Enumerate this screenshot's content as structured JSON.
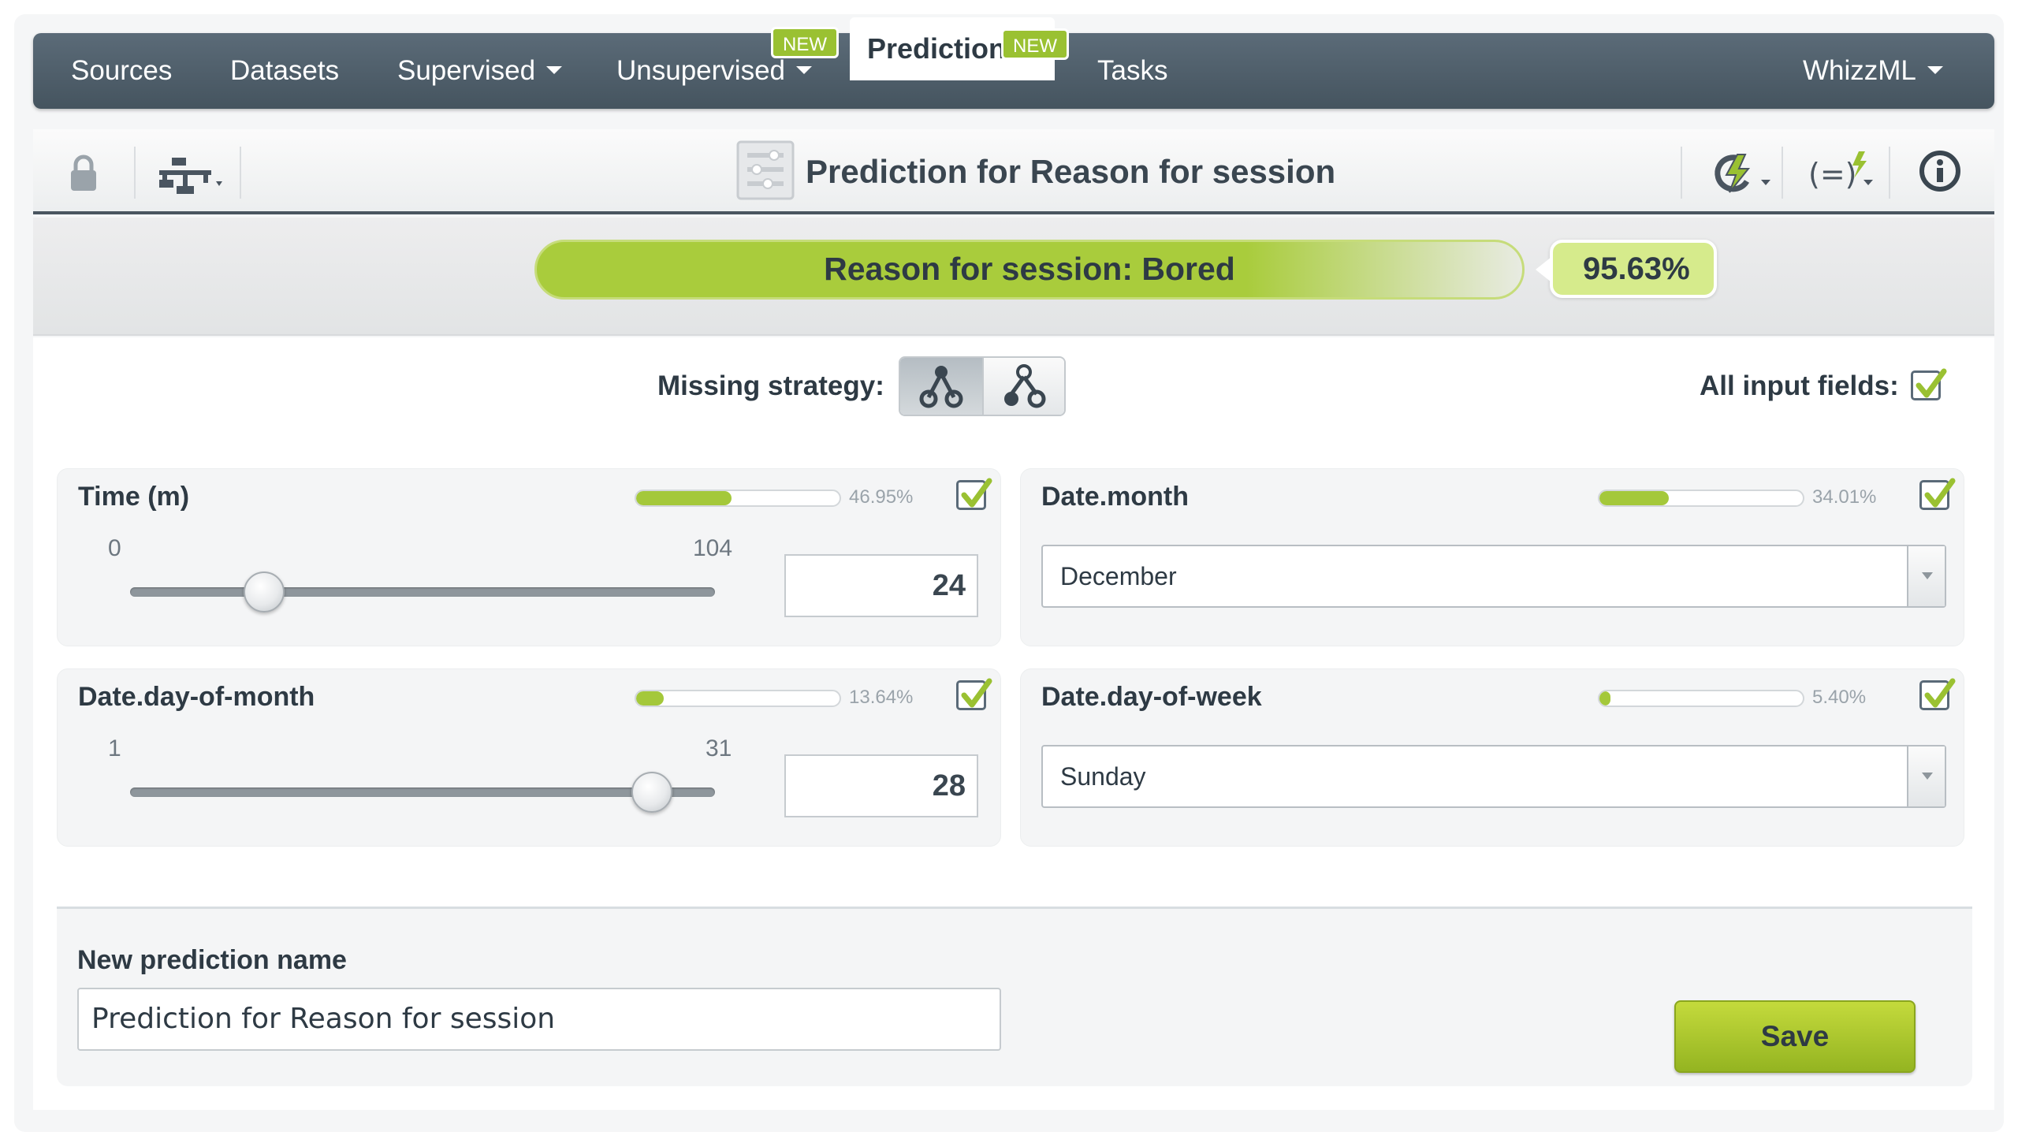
{
  "nav": {
    "items": [
      {
        "label": "Sources"
      },
      {
        "label": "Datasets"
      },
      {
        "label": "Supervised"
      },
      {
        "label": "Unsupervised",
        "badge": "NEW"
      },
      {
        "label": "Predictions",
        "badge": "NEW"
      },
      {
        "label": "Tasks"
      },
      {
        "label": "WhizzML"
      }
    ],
    "active": "Predictions"
  },
  "toolbar": {
    "title": "Prediction for Reason for session",
    "icons": [
      "lock-icon",
      "model-tree-icon",
      "predictions-icon",
      "formula-icon",
      "info-icon"
    ]
  },
  "result": {
    "label": "Reason for session: Bored",
    "confidence": "95.63%",
    "confidence_fraction": 0.9563
  },
  "controls": {
    "missing_strategy_label": "Missing strategy:",
    "all_inputs_label": "All input fields:",
    "all_inputs_checked": true
  },
  "fields": [
    {
      "name": "Time (m)",
      "importance": "46.95%",
      "importance_fraction": 0.4695,
      "checked": true,
      "type": "numeric",
      "min": "0",
      "max": "104",
      "value": "24"
    },
    {
      "name": "Date.month",
      "importance": "34.01%",
      "importance_fraction": 0.3401,
      "checked": true,
      "type": "categorical",
      "value": "December"
    },
    {
      "name": "Date.day-of-month",
      "importance": "13.64%",
      "importance_fraction": 0.1364,
      "checked": true,
      "type": "numeric",
      "min": "1",
      "max": "31",
      "value": "28"
    },
    {
      "name": "Date.day-of-week",
      "importance": "5.40%",
      "importance_fraction": 0.054,
      "checked": true,
      "type": "categorical",
      "value": "Sunday"
    }
  ],
  "name_panel": {
    "label": "New prediction name",
    "value": "Prediction for Reason for session",
    "save_label": "Save"
  },
  "colors": {
    "nav": "#4f5e6b",
    "accent": "#a4c83a",
    "save": "#b5cc30"
  }
}
